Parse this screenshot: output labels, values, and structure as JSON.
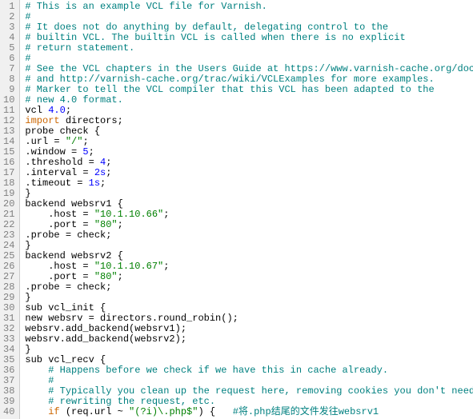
{
  "lines": [
    {
      "n": 1,
      "t": "comment",
      "text": "# This is an example VCL file for Varnish."
    },
    {
      "n": 2,
      "t": "comment",
      "text": "#"
    },
    {
      "n": 3,
      "t": "comment",
      "text": "# It does not do anything by default, delegating control to the"
    },
    {
      "n": 4,
      "t": "comment",
      "text": "# builtin VCL. The builtin VCL is called when there is no explicit"
    },
    {
      "n": 5,
      "t": "comment",
      "text": "# return statement."
    },
    {
      "n": 6,
      "t": "comment",
      "text": "#"
    },
    {
      "n": 7,
      "t": "comment",
      "text": "# See the VCL chapters in the Users Guide at https://www.varnish-cache.org/docs"
    },
    {
      "n": 8,
      "t": "comment",
      "text": "# and http://varnish-cache.org/trac/wiki/VCLExamples for more examples."
    },
    {
      "n": 9,
      "t": "comment",
      "text": "# Marker to tell the VCL compiler that this VCL has been adapted to the"
    },
    {
      "n": 10,
      "t": "comment",
      "text": "# new 4.0 format."
    },
    {
      "n": 11,
      "t": "code",
      "html": "vcl <span class='num'>4.0</span>;"
    },
    {
      "n": 12,
      "t": "code",
      "html": "<span class='kw'>import</span> directors;"
    },
    {
      "n": 13,
      "t": "code",
      "html": "probe check {"
    },
    {
      "n": 14,
      "t": "code",
      "html": ".url = <span class='str'>\"/\"</span>;"
    },
    {
      "n": 15,
      "t": "code",
      "html": ".window = <span class='num'>5</span>;"
    },
    {
      "n": 16,
      "t": "code",
      "html": ".threshold = <span class='num'>4</span>;"
    },
    {
      "n": 17,
      "t": "code",
      "html": ".interval = <span class='num'>2s</span>;"
    },
    {
      "n": 18,
      "t": "code",
      "html": ".timeout = <span class='num'>1s</span>;"
    },
    {
      "n": 19,
      "t": "code",
      "html": "}"
    },
    {
      "n": 20,
      "t": "code",
      "html": "backend websrv1 {"
    },
    {
      "n": 21,
      "t": "code",
      "html": "    .host = <span class='str'>\"10.1.10.66\"</span>;"
    },
    {
      "n": 22,
      "t": "code",
      "html": "    .port = <span class='str'>\"80\"</span>;"
    },
    {
      "n": 23,
      "t": "code",
      "html": ".probe = check;"
    },
    {
      "n": 24,
      "t": "code",
      "html": "}"
    },
    {
      "n": 25,
      "t": "code",
      "html": "backend websrv2 {"
    },
    {
      "n": 26,
      "t": "code",
      "html": "    .host = <span class='str'>\"10.1.10.67\"</span>;"
    },
    {
      "n": 27,
      "t": "code",
      "html": "    .port = <span class='str'>\"80\"</span>;"
    },
    {
      "n": 28,
      "t": "code",
      "html": ".probe = check;"
    },
    {
      "n": 29,
      "t": "code",
      "html": "}"
    },
    {
      "n": 30,
      "t": "code",
      "html": "sub vcl_init {"
    },
    {
      "n": 31,
      "t": "code",
      "html": "new websrv = directors.round_robin();"
    },
    {
      "n": 32,
      "t": "code",
      "html": "websrv.add_backend(websrv1);"
    },
    {
      "n": 33,
      "t": "code",
      "html": "websrv.add_backend(websrv2);"
    },
    {
      "n": 34,
      "t": "code",
      "html": "}"
    },
    {
      "n": 35,
      "t": "code",
      "html": "sub vcl_recv {"
    },
    {
      "n": 36,
      "t": "code",
      "html": "    <span class='cm'># Happens before we check if we have this in cache already.</span>"
    },
    {
      "n": 37,
      "t": "code",
      "html": "    <span class='cm'>#</span>"
    },
    {
      "n": 38,
      "t": "code",
      "html": "    <span class='cm'># Typically you clean up the request here, removing cookies you don't need,</span>"
    },
    {
      "n": 39,
      "t": "code",
      "html": "    <span class='cm'># rewriting the request, etc.</span>"
    },
    {
      "n": 40,
      "t": "code",
      "html": "    <span class='kw'>if</span> (req.url ~ <span class='str'>\"(?i)\\.php$\"</span>) {   <span class='cm'>#将.php结尾的文件发往websrv1</span>"
    }
  ]
}
